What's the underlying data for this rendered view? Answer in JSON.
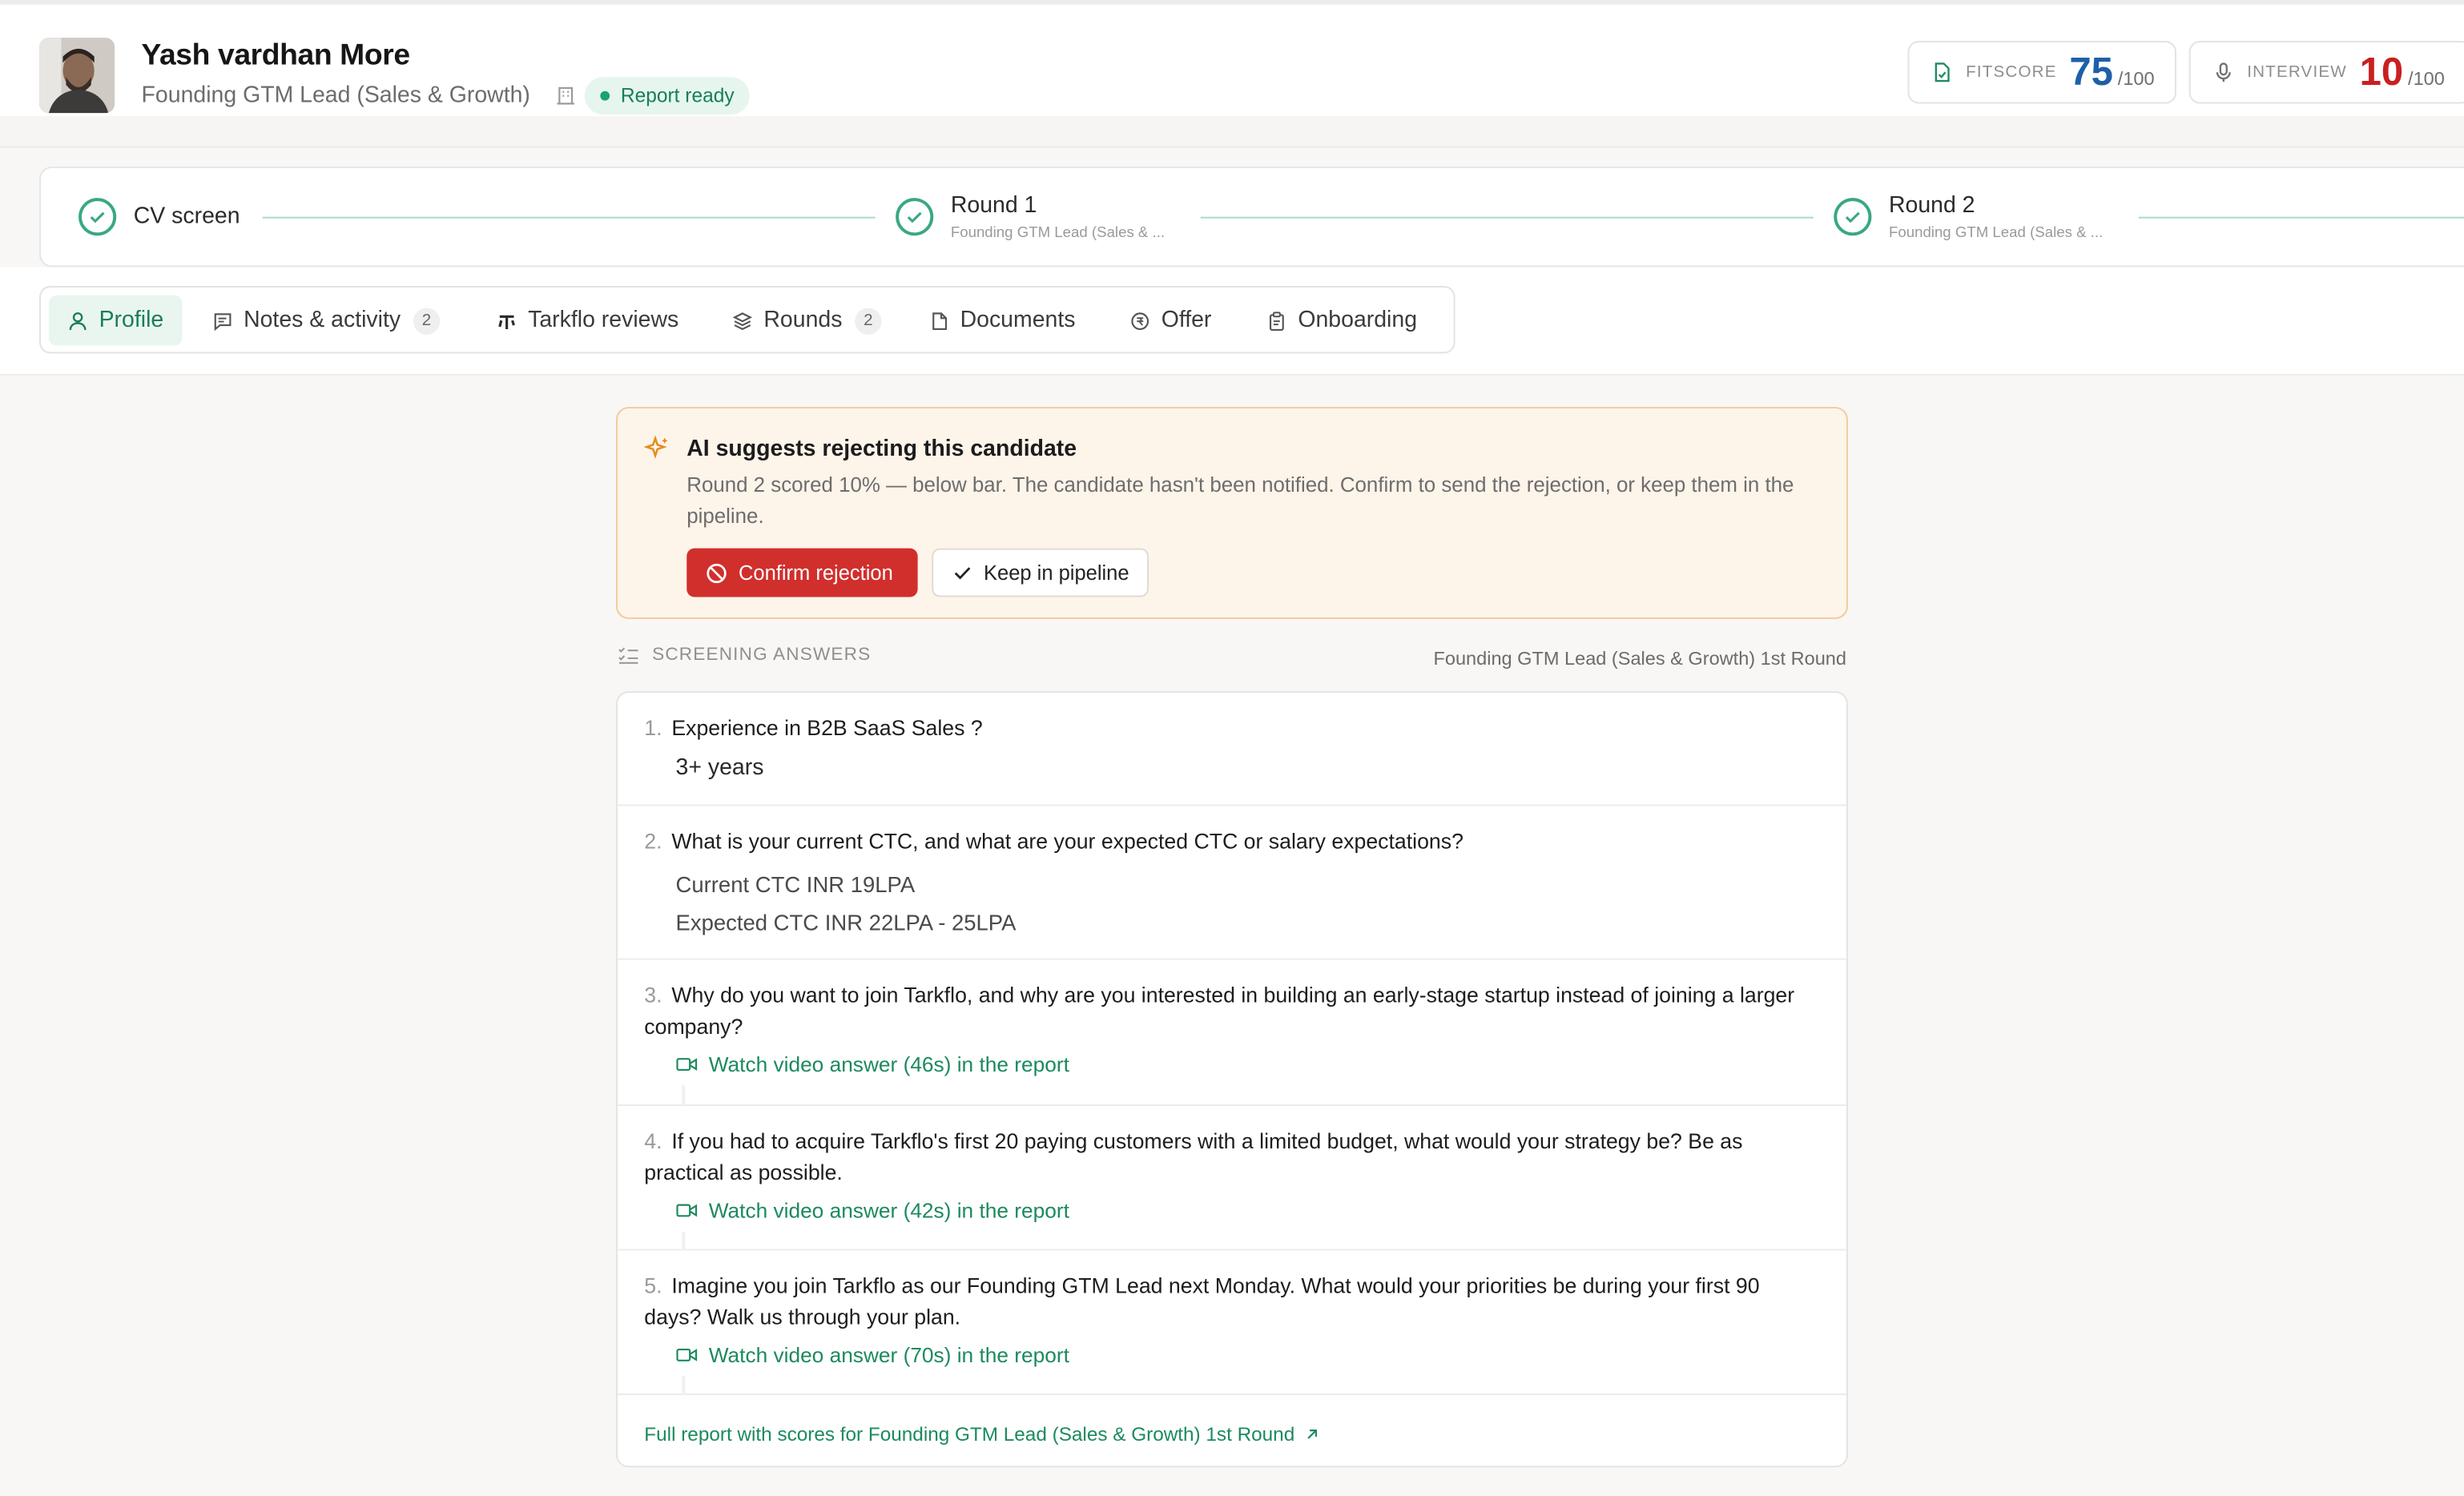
{
  "candidate": {
    "name": "Yash vardhan More",
    "role": "Founding GTM Lead (Sales & Growth)",
    "status": "Report ready"
  },
  "scores": {
    "fitscore": {
      "label": "FITSCORE",
      "value": "75",
      "denominator": "/100",
      "color": "#1e5fa8"
    },
    "interview": {
      "label": "INTERVIEW",
      "value": "10",
      "denominator": "/100",
      "color": "#c92020"
    }
  },
  "pipeline": {
    "steps": [
      {
        "title": "CV screen",
        "subtitle": ""
      },
      {
        "title": "Round 1",
        "subtitle": "Founding GTM Lead (Sales & ..."
      },
      {
        "title": "Round 2",
        "subtitle": "Founding GTM Lead (Sales & ..."
      }
    ]
  },
  "tabs": [
    {
      "label": "Profile",
      "active": true,
      "icon": "user-icon"
    },
    {
      "label": "Notes & activity",
      "count": "2",
      "icon": "message-icon"
    },
    {
      "label": "Tarkflo reviews",
      "icon": "tarkflo-logo-icon"
    },
    {
      "label": "Rounds",
      "count": "2",
      "icon": "layers-icon"
    },
    {
      "label": "Documents",
      "icon": "file-icon"
    },
    {
      "label": "Offer",
      "icon": "coin-icon"
    },
    {
      "label": "Onboarding",
      "icon": "clipboard-icon"
    }
  ],
  "ai_suggestion": {
    "title": "AI suggests rejecting this candidate",
    "description": "Round 2 scored 10% — below bar. The candidate hasn't been notified. Confirm to send the rejection, or keep them in the pipeline.",
    "confirm_label": "Confirm rejection",
    "keep_label": "Keep in pipeline"
  },
  "screening": {
    "heading": "SCREENING ANSWERS",
    "round_label": "Founding GTM Lead (Sales & Growth) 1st Round",
    "questions": [
      {
        "num": "1.",
        "question": "Experience in B2B SaaS Sales ?",
        "answer": "3+ years"
      },
      {
        "num": "2.",
        "question": "What is your current CTC, and what are your expected CTC or salary expectations?",
        "answer_lines": [
          "Current CTC INR 19LPA",
          "Expected CTC INR 22LPA - 25LPA"
        ]
      },
      {
        "num": "3.",
        "question": "Why do you want to join Tarkflo, and why are you interested in building an early-stage startup instead of joining a larger company?",
        "video": "Watch video answer (46s) in the report"
      },
      {
        "num": "4.",
        "question": "If you had to acquire Tarkflo's first 20 paying customers with a limited budget, what would your strategy be? Be as practical as possible.",
        "video": "Watch video answer (42s) in the report"
      },
      {
        "num": "5.",
        "question": "Imagine you join Tarkflo as our Founding GTM Lead next Monday. What would your priorities be during your first 90 days? Walk us through your plan.",
        "video": "Watch video answer (70s) in the report"
      }
    ],
    "full_report_link": "Full report with scores for Founding GTM Lead (Sales & Growth) 1st Round"
  }
}
